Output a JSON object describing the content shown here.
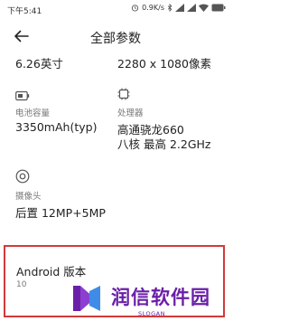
{
  "status_bar": {
    "time": "下午5:41",
    "network_speed": "0.9K/s",
    "battery_level": "100"
  },
  "header": {
    "title": "全部参数"
  },
  "specs": {
    "screen_size": "6.26英寸",
    "resolution": "2280 x 1080像素",
    "battery": {
      "icon": "battery-icon",
      "label": "电池容量",
      "value": "3350mAh(typ)"
    },
    "processor": {
      "icon": "chip-icon",
      "label": "处理器",
      "value_line1": "高通骁龙660",
      "value_line2": "八核 最高 2.2GHz"
    },
    "camera": {
      "icon": "camera-icon",
      "label": "摄像头",
      "value": "后置 12MP+5MP"
    }
  },
  "android": {
    "title": "Android 版本",
    "version": "10"
  },
  "watermark": {
    "text": "润信软件园",
    "slogan": "SLOGAN"
  },
  "colors": {
    "highlight_border": "#d23a3a",
    "watermark": "#6a1fa8"
  }
}
